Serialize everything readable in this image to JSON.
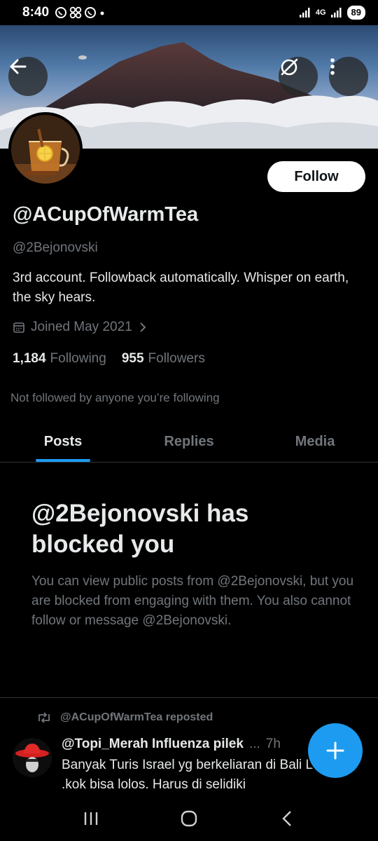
{
  "status_bar": {
    "time": "8:40",
    "left_icons": [
      "whatsapp-icon",
      "pinwheel-icon",
      "whatsapp-icon",
      "dot-icon"
    ],
    "network": "4G",
    "battery": "89"
  },
  "banner": {
    "description_icons": [
      "back-arrow-icon",
      "unmute-icon",
      "more-vertical-icon"
    ]
  },
  "profile": {
    "display_name": "@ACupOfWarmTea",
    "handle": "@2Bejonovski",
    "bio": "3rd account. Followback automatically. Whisper on earth, the sky hears.",
    "joined": "Joined May 2021",
    "following_count": "1,184",
    "following_label": "Following",
    "followers_count": "955",
    "followers_label": "Followers",
    "not_followed_text": "Not followed by anyone you’re following",
    "follow_button": "Follow"
  },
  "tabs": [
    {
      "label": "Posts",
      "active": true
    },
    {
      "label": "Replies",
      "active": false
    },
    {
      "label": "Media",
      "active": false
    }
  ],
  "blocked": {
    "title": "@2Bejonovski has blocked you",
    "text": "You can view public posts from @2Bejonovski, but you are blocked from engaging with them. You also cannot follow or message @2Bejonovski."
  },
  "post": {
    "repost_label": "@ACupOfWarmTea reposted",
    "author": "@Topi_Merah Influenza pilek",
    "ellipsis": "...",
    "time": "7h",
    "body": "Banyak Turis Israel yg berkeliaran di Bali Lombok .kok bisa lolos. Harus di selidiki"
  },
  "colors": {
    "accent": "#1d9bf0",
    "background": "#000000",
    "text_primary": "#e7e9ea",
    "text_secondary": "#71767b"
  }
}
